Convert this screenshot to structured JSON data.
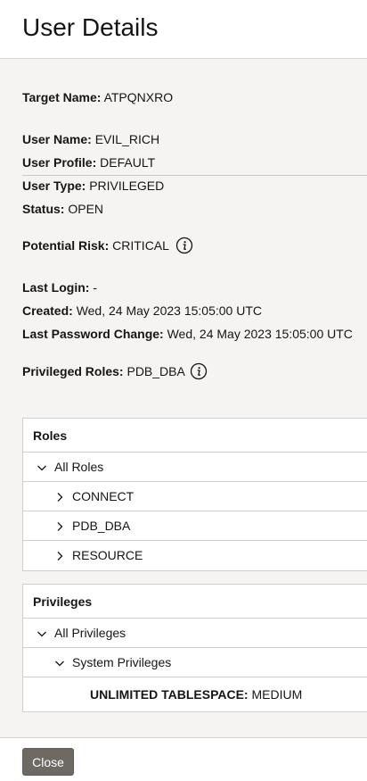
{
  "dialog": {
    "title": "User Details"
  },
  "details": {
    "target_name": {
      "label": "Target Name:",
      "value": "ATPQNXRO"
    },
    "user_name": {
      "label": "User Name:",
      "value": "EVIL_RICH"
    },
    "user_profile": {
      "label": "User Profile:",
      "value": "DEFAULT"
    },
    "user_type": {
      "label": "User Type:",
      "value": "PRIVILEGED"
    },
    "status": {
      "label": "Status:",
      "value": "OPEN"
    },
    "potential_risk": {
      "label": "Potential Risk:",
      "value": "CRITICAL",
      "icon": "info-icon"
    },
    "last_login": {
      "label": "Last Login:",
      "value": "-"
    },
    "created": {
      "label": "Created:",
      "value": "Wed, 24 May 2023 15:05:00 UTC"
    },
    "last_password_change": {
      "label": "Last Password Change:",
      "value": "Wed, 24 May 2023 15:05:00 UTC"
    },
    "privileged_roles": {
      "label": "Privileged Roles:",
      "value": "PDB_DBA",
      "icon": "info-icon"
    }
  },
  "roles_panel": {
    "header": "Roles",
    "root": {
      "label": "All Roles",
      "expanded": true,
      "icon": "chevron-down-icon"
    },
    "items": [
      {
        "label": "CONNECT",
        "icon": "chevron-right-icon"
      },
      {
        "label": "PDB_DBA",
        "icon": "chevron-right-icon"
      },
      {
        "label": "RESOURCE",
        "icon": "chevron-right-icon"
      }
    ]
  },
  "privileges_panel": {
    "header": "Privileges",
    "root": {
      "label": "All Privileges",
      "expanded": true,
      "icon": "chevron-down-icon"
    },
    "group": {
      "label": "System Privileges",
      "expanded": true,
      "icon": "chevron-down-icon"
    },
    "leaf": {
      "label": "UNLIMITED TABLESPACE:",
      "value": "MEDIUM"
    }
  },
  "footer": {
    "close_label": "Close"
  },
  "colors": {
    "button_bg": "#6f6964",
    "panel_border": "#d0cecb",
    "page_bg": "#f5f4f2"
  }
}
